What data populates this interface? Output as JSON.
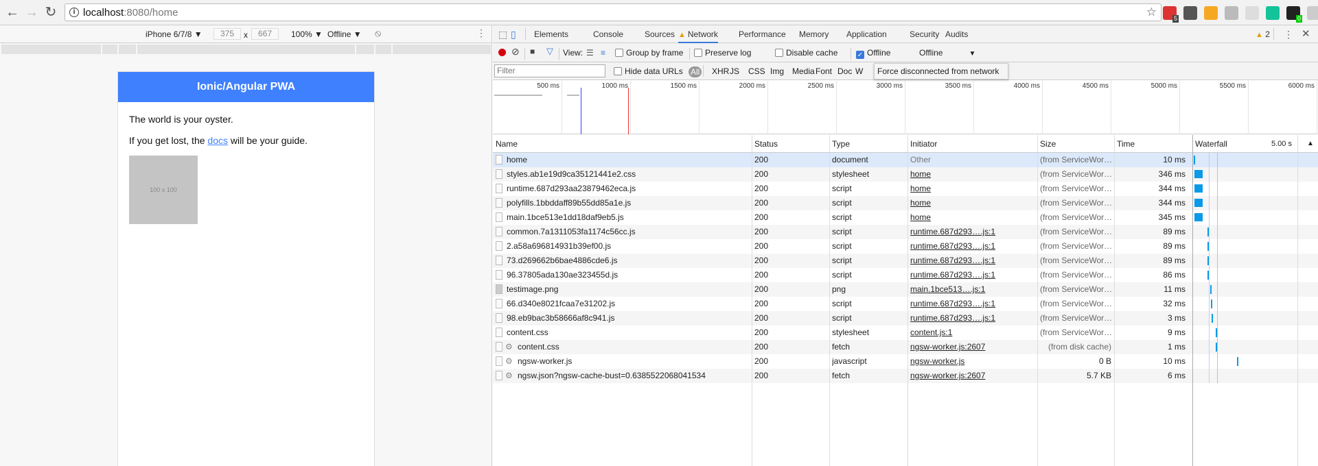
{
  "browser": {
    "url_host": "localhost",
    "url_rest": ":8080/home",
    "extensions": [
      {
        "icon": "todoist-icon",
        "badge": "5",
        "color": "#d33"
      },
      {
        "icon": "evernote-icon",
        "badge": "",
        "color": "#555"
      },
      {
        "icon": "star-extension-icon",
        "badge": "",
        "color": "#f7a823"
      },
      {
        "icon": "css-icon",
        "badge": "",
        "color": "#bbb"
      },
      {
        "icon": "page-icon",
        "badge": "",
        "color": "#ddd"
      },
      {
        "icon": "grammarly-icon",
        "badge": "",
        "color": "#15c39a"
      },
      {
        "icon": "calendar-icon",
        "badge": "0",
        "color": "#222"
      },
      {
        "icon": "mail-icon",
        "badge": "",
        "color": "#ccc"
      },
      {
        "icon": "upload-icon",
        "badge": "",
        "color": "#d9412e"
      }
    ]
  },
  "device_toolbar": {
    "device": "iPhone 6/7/8 ▼",
    "width": "375",
    "times": "x",
    "height": "667",
    "zoom": "100% ▼",
    "network": "Offline ▼"
  },
  "page": {
    "header": "Ionic/Angular PWA",
    "line1": "The world is your oyster.",
    "line2_before": "If you get lost, the ",
    "line2_link": "docs",
    "line2_after": " will be your guide.",
    "image_placeholder": "100 x 100",
    "accent": "#3f80fe"
  },
  "devtools": {
    "tabs": [
      "Elements",
      "Console",
      "Sources",
      "Network",
      "Performance",
      "Memory",
      "Application",
      "Security",
      "Audits"
    ],
    "active_tab": "Network",
    "warning_count": "2",
    "toolbar": {
      "view_label": "View:",
      "group_by_frame": "Group by frame",
      "preserve_log": "Preserve log",
      "disable_cache": "Disable cache",
      "offline": "Offline",
      "throttle": "Offline",
      "offline_checked": true
    },
    "filter": {
      "placeholder": "Filter",
      "hide_data_urls": "Hide data URLs",
      "types": [
        "All",
        "XHR",
        "JS",
        "CSS",
        "Img",
        "Media",
        "Font",
        "Doc",
        "W"
      ]
    },
    "tooltip": "Force disconnected from network",
    "overview_ticks": [
      "500 ms",
      "1000 ms",
      "1500 ms",
      "2000 ms",
      "2500 ms",
      "3000 ms",
      "3500 ms",
      "4000 ms",
      "4500 ms",
      "5000 ms",
      "5500 ms",
      "6000 ms"
    ],
    "dom_content_loaded_ms": 640,
    "load_ms": 985,
    "columns": [
      "Name",
      "Status",
      "Type",
      "Initiator",
      "Size",
      "Time",
      "Waterfall"
    ],
    "waterfall_scale": "5.00 s",
    "rows": [
      {
        "name": "home",
        "status": "200",
        "type": "document",
        "initiator": "Other",
        "size": "(from ServiceWor…",
        "time": "10 ms",
        "wf_start_ms": 0,
        "icon": "doc",
        "selected": true
      },
      {
        "name": "styles.ab1e19d9ca35121441e2.css",
        "status": "200",
        "type": "stylesheet",
        "initiator": "home",
        "size": "(from ServiceWor…",
        "time": "346 ms",
        "wf_start_ms": 30,
        "icon": "doc"
      },
      {
        "name": "runtime.687d293aa23879462eca.js",
        "status": "200",
        "type": "script",
        "initiator": "home",
        "size": "(from ServiceWor…",
        "time": "344 ms",
        "wf_start_ms": 30,
        "icon": "doc"
      },
      {
        "name": "polyfills.1bbddaff89b55dd85a1e.js",
        "status": "200",
        "type": "script",
        "initiator": "home",
        "size": "(from ServiceWor…",
        "time": "344 ms",
        "wf_start_ms": 30,
        "icon": "doc"
      },
      {
        "name": "main.1bce513e1dd18daf9eb5.js",
        "status": "200",
        "type": "script",
        "initiator": "home",
        "size": "(from ServiceWor…",
        "time": "345 ms",
        "wf_start_ms": 30,
        "icon": "doc"
      },
      {
        "name": "common.7a1311053fa1174c56cc.js",
        "status": "200",
        "type": "script",
        "initiator": "runtime.687d293….js:1",
        "size": "(from ServiceWor…",
        "time": "89 ms",
        "wf_start_ms": 580,
        "icon": "doc"
      },
      {
        "name": "2.a58a696814931b39ef00.js",
        "status": "200",
        "type": "script",
        "initiator": "runtime.687d293….js:1",
        "size": "(from ServiceWor…",
        "time": "89 ms",
        "wf_start_ms": 580,
        "icon": "doc"
      },
      {
        "name": "73.d269662b6bae4886cde6.js",
        "status": "200",
        "type": "script",
        "initiator": "runtime.687d293….js:1",
        "size": "(from ServiceWor…",
        "time": "89 ms",
        "wf_start_ms": 580,
        "icon": "doc"
      },
      {
        "name": "96.37805ada130ae323455d.js",
        "status": "200",
        "type": "script",
        "initiator": "runtime.687d293….js:1",
        "size": "(from ServiceWor…",
        "time": "86 ms",
        "wf_start_ms": 580,
        "icon": "doc"
      },
      {
        "name": "testimage.png",
        "status": "200",
        "type": "png",
        "initiator": "main.1bce513….js:1",
        "size": "(from ServiceWor…",
        "time": "11 ms",
        "wf_start_ms": 700,
        "icon": "img"
      },
      {
        "name": "66.d340e8021fcaa7e31202.js",
        "status": "200",
        "type": "script",
        "initiator": "runtime.687d293….js:1",
        "size": "(from ServiceWor…",
        "time": "32 ms",
        "wf_start_ms": 720,
        "icon": "doc"
      },
      {
        "name": "98.eb9bac3b58666af8c941.js",
        "status": "200",
        "type": "script",
        "initiator": "runtime.687d293….js:1",
        "size": "(from ServiceWor…",
        "time": "3 ms",
        "wf_start_ms": 750,
        "icon": "doc"
      },
      {
        "name": "content.css",
        "status": "200",
        "type": "stylesheet",
        "initiator": "content.js:1",
        "size": "(from ServiceWor…",
        "time": "9 ms",
        "wf_start_ms": 930,
        "icon": "doc"
      },
      {
        "name": "content.css",
        "status": "200",
        "type": "fetch",
        "initiator": "ngsw-worker.js:2607",
        "size": "(from disk cache)",
        "time": "1 ms",
        "wf_start_ms": 930,
        "icon": "gear"
      },
      {
        "name": "ngsw-worker.js",
        "status": "200",
        "type": "javascript",
        "initiator": "ngsw-worker.js",
        "size": "0 B",
        "time": "10 ms",
        "wf_start_ms": 1830,
        "icon": "gear"
      },
      {
        "name": "ngsw.json?ngsw-cache-bust=0.6385522068041534",
        "status": "200",
        "type": "fetch",
        "initiator": "ngsw-worker.js:2607",
        "size": "5.7 KB",
        "time": "6 ms",
        "wf_start_ms": 5250,
        "icon": "gear"
      }
    ]
  }
}
